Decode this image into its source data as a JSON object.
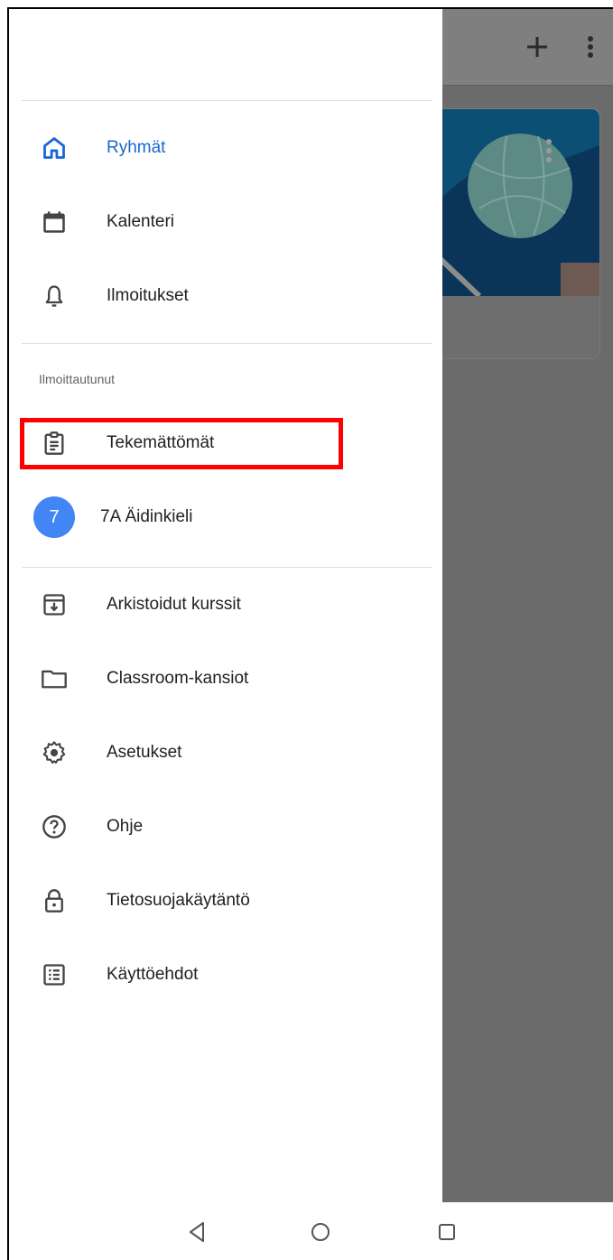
{
  "drawer": {
    "nav_items": [
      {
        "label": "Ryhmät",
        "icon": "home-icon",
        "active": true
      },
      {
        "label": "Kalenteri",
        "icon": "calendar-icon"
      },
      {
        "label": "Ilmoitukset",
        "icon": "bell-icon"
      }
    ],
    "enrolled_section": {
      "header": "Ilmoittautunut",
      "items": [
        {
          "label": "Tekemättömät",
          "icon": "assignment-icon"
        },
        {
          "label": "7A Äidinkieli",
          "avatar_letter": "7",
          "avatar_color": "#4285f4"
        }
      ]
    },
    "other_items": [
      {
        "label": "Arkistoidut kurssit",
        "icon": "archive-icon"
      },
      {
        "label": "Classroom-kansiot",
        "icon": "folder-icon"
      },
      {
        "label": "Asetukset",
        "icon": "settings-icon"
      },
      {
        "label": "Ohje",
        "icon": "help-icon"
      },
      {
        "label": "Tietosuojakäytäntö",
        "icon": "lock-icon"
      },
      {
        "label": "Käyttöehdot",
        "icon": "terms-icon"
      }
    ]
  },
  "background_app": {
    "toolbar_icons": [
      "plus-icon",
      "more-vert-icon"
    ],
    "course_card": {
      "banner_theme": "volleyball",
      "banner_color": "#0b4f74"
    }
  },
  "system_nav": [
    "back-icon",
    "home-circle-icon",
    "recents-icon"
  ],
  "colors": {
    "accent": "#1967d2",
    "highlight": "#ff0000",
    "scrim": "#6b6b6b",
    "avatar": "#4285f4"
  }
}
